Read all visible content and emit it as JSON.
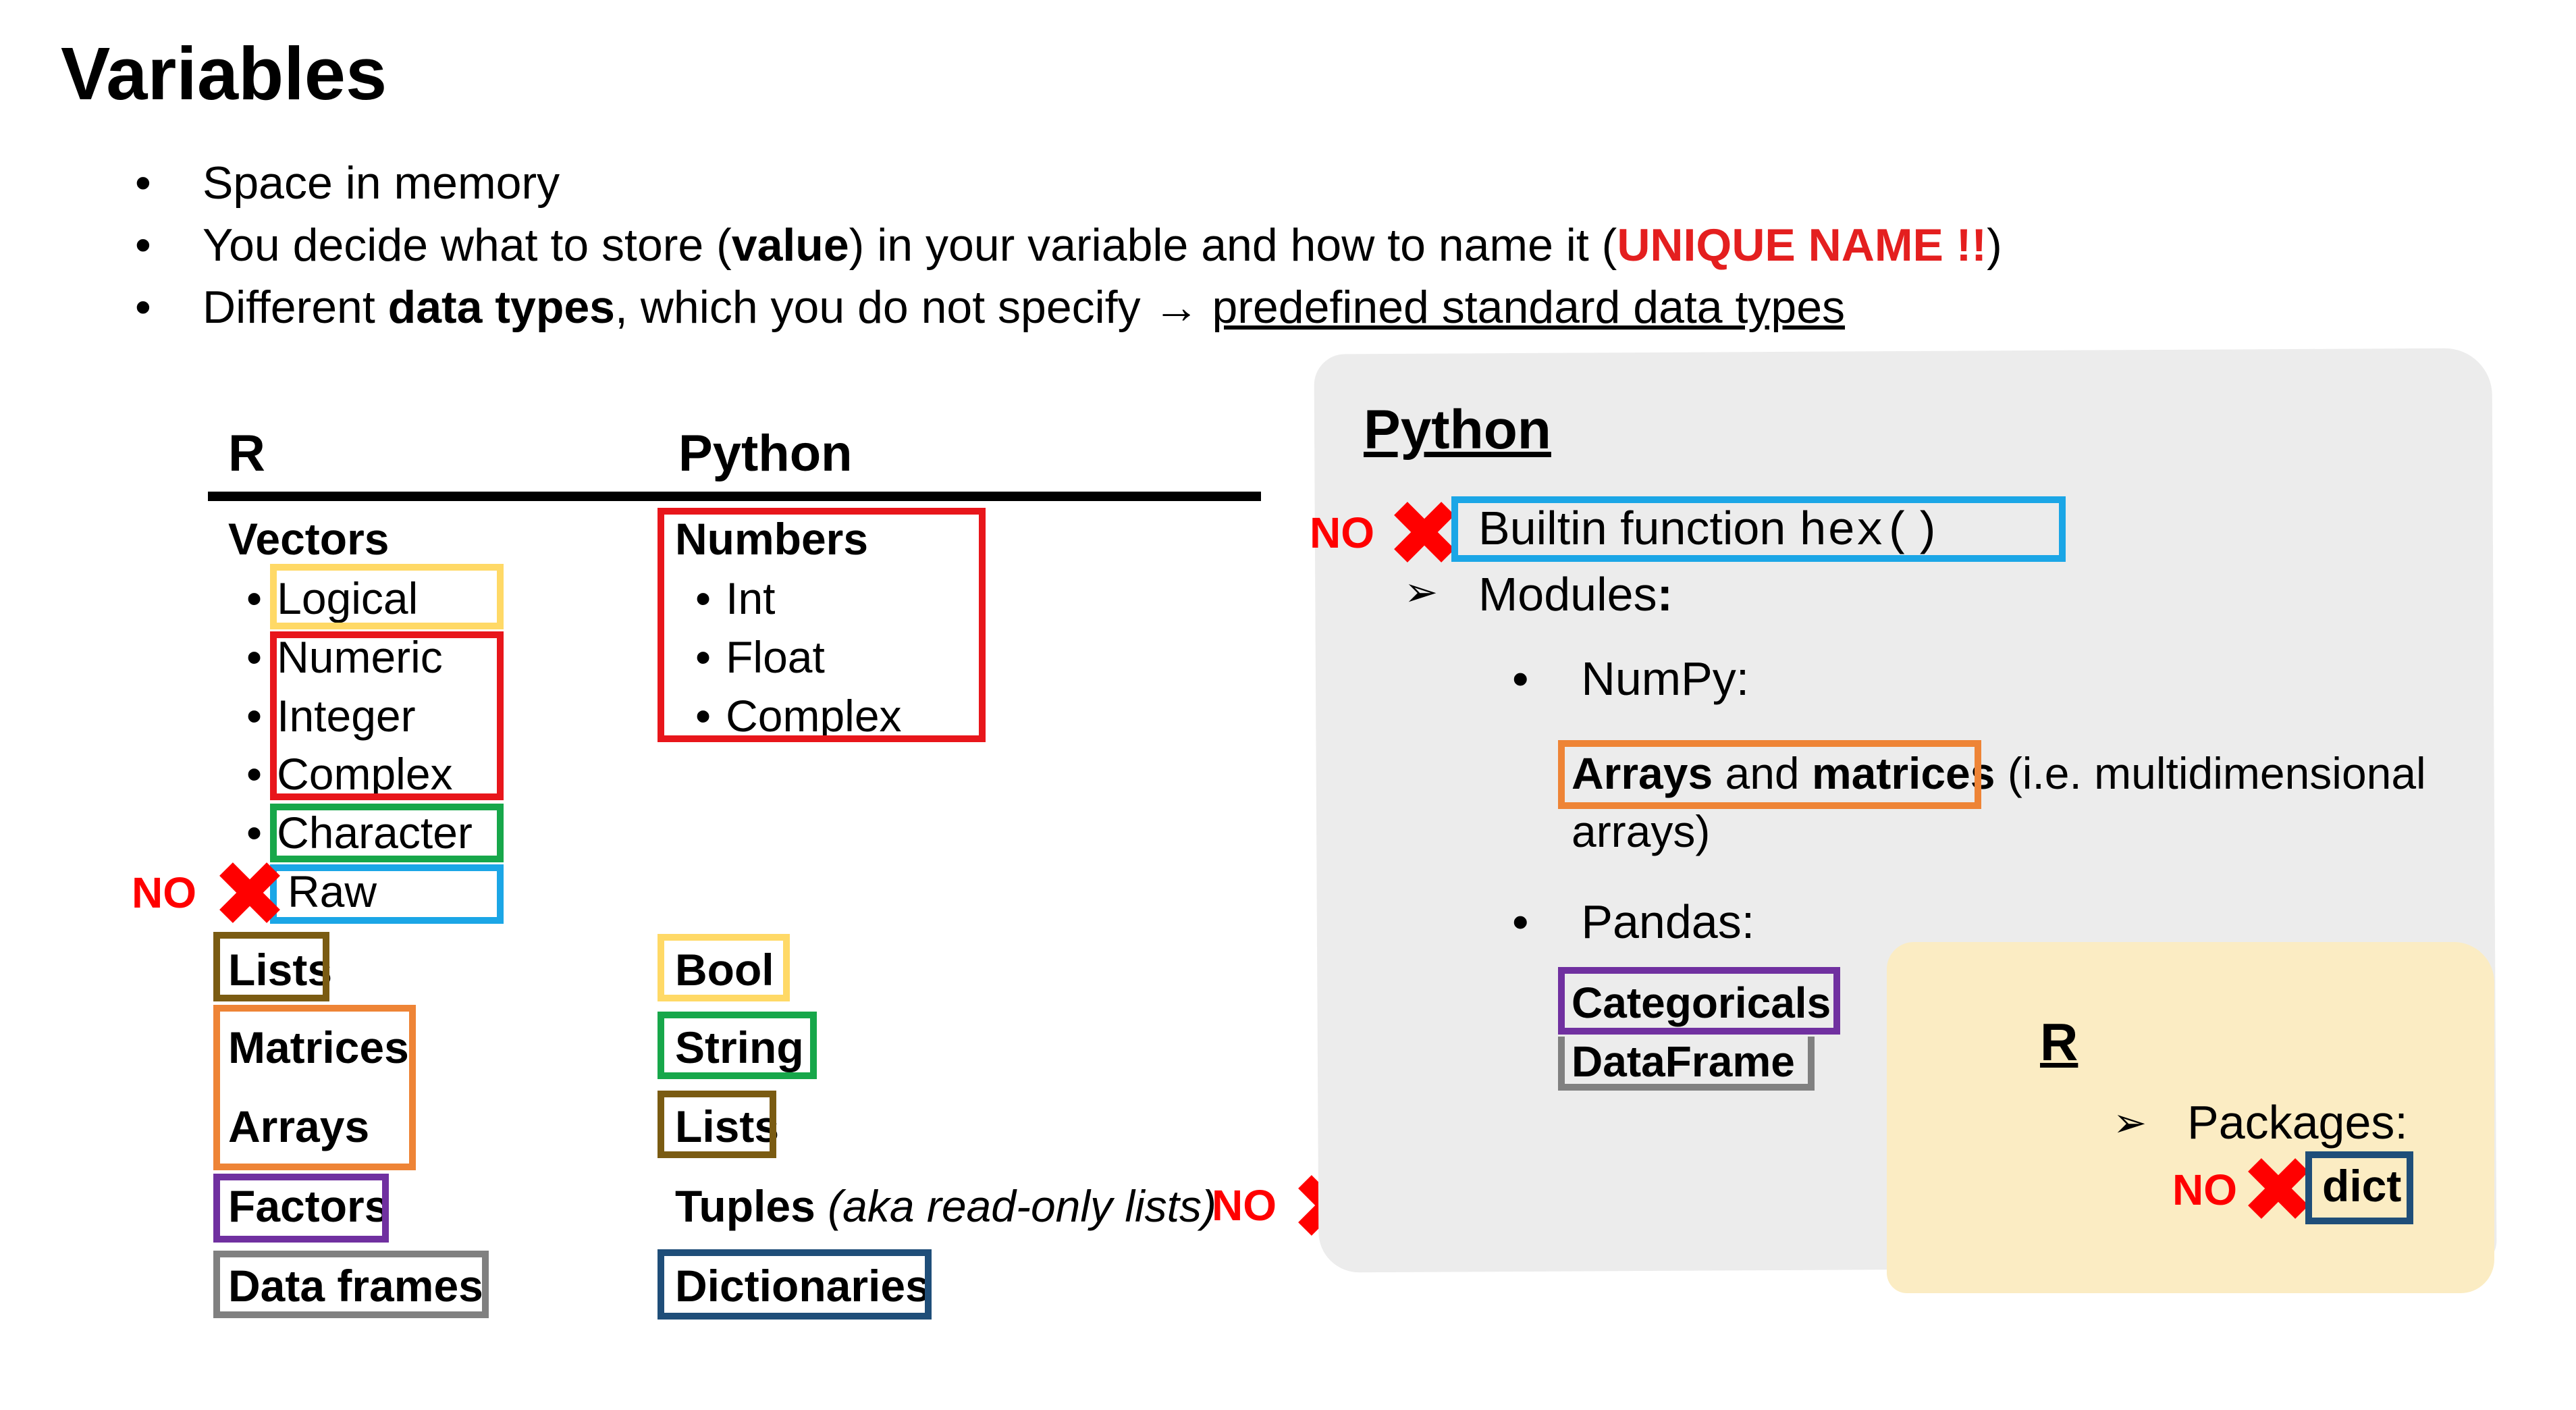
{
  "slide": {
    "title": "Variables",
    "bullets": {
      "b1": "Space in memory",
      "b2_a": "You decide what to store (",
      "b2_value": "value",
      "b2_b": ") in your variable and how to name it (",
      "b2_unique": "UNIQUE NAME !!",
      "b2_c": ")",
      "b3_a": "Different ",
      "b3_bold": "data types",
      "b3_b": ", which you do not specify ",
      "b3_arrow": "→",
      "b3_link": "predefined standard data types"
    }
  },
  "table": {
    "r_header": "R",
    "py_header": "Python",
    "r": {
      "vectors": "Vectors",
      "logical": "Logical",
      "numeric": "Numeric",
      "integer": "Integer",
      "complex": "Complex",
      "character": "Character",
      "raw": "Raw",
      "lists": "Lists",
      "matrices": "Matrices",
      "arrays": "Arrays",
      "factors": "Factors",
      "data_frames": "Data frames"
    },
    "py": {
      "numbers": "Numbers",
      "int": "Int",
      "float": "Float",
      "complex": "Complex",
      "bool": "Bool",
      "string": "String",
      "lists": "Lists",
      "tuples": "Tuples",
      "tuples_note": "(aka read-only lists)",
      "dictionaries": "Dictionaries"
    }
  },
  "no_label": "NO",
  "python_panel": {
    "title": "Python",
    "builtin_text": "Builtin function ",
    "builtin_code": "hex()",
    "modules": "Modules",
    "modules_colon": ":",
    "numpy": "NumPy:",
    "arrays": "Arrays",
    "and": " and ",
    "matrices": "matrices",
    "ie": "(i.e. multidimensional",
    "ie2": "arrays)",
    "pandas": "Pandas:",
    "categoricals": "Categoricals",
    "dataframe": "DataFrame"
  },
  "r_panel": {
    "title": "R",
    "packages": "Packages:",
    "dict": "dict"
  },
  "colors": {
    "yellow": "#ffd966",
    "red": "#e8161b",
    "green": "#17a74a",
    "blue": "#1ba6e6",
    "brown": "#7a5b12",
    "orange": "#ee8436",
    "purple": "#7030a0",
    "gray": "#808080",
    "navy": "#1f4e79",
    "no_red": "#ff0000"
  }
}
